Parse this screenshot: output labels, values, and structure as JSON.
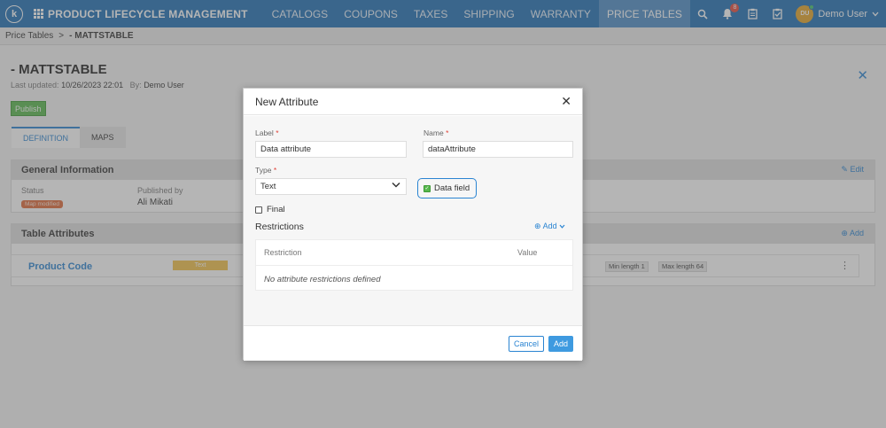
{
  "topbar": {
    "logo": "k",
    "app_title": "PRODUCT LIFECYCLE MANAGEMENT",
    "nav": [
      "CATALOGS",
      "COUPONS",
      "TAXES",
      "SHIPPING",
      "WARRANTY",
      "PRICE TABLES"
    ],
    "active_nav": "PRICE TABLES",
    "notification_count": "8",
    "avatar_initials": "DU",
    "user_name": "Demo User",
    "icons": [
      "search-icon",
      "bell-icon",
      "clipboard-icon",
      "checklist-icon",
      "chevron-down-icon"
    ]
  },
  "breadcrumb": {
    "parent": "Price Tables",
    "separator": ">",
    "current": "- MATTSTABLE"
  },
  "page": {
    "title": "- MATTSTABLE",
    "updated_label": "Last updated:",
    "updated_value": "10/26/2023 22:01",
    "by_label": "By:",
    "by_value": "Demo User",
    "publish_label": "Publish",
    "tabs": [
      "DEFINITION",
      "MAPS"
    ]
  },
  "general": {
    "title": "General Information",
    "edit_label": "Edit",
    "status_label": "Status",
    "status_value": "Map modified",
    "published_by_label": "Published by",
    "published_by_value": "Ali Mikati"
  },
  "table_attributes": {
    "title": "Table Attributes",
    "add_label": "Add",
    "rows": [
      {
        "name": "Product Code",
        "type": "Text",
        "restrictions": [
          "Min length 1",
          "Max length 64"
        ]
      }
    ]
  },
  "modal": {
    "title": "New Attribute",
    "label_label": "Label",
    "label_value": "Data attribute",
    "name_label": "Name",
    "name_value": "dataAttribute",
    "type_label": "Type",
    "type_value": "Text",
    "data_field_label": "Data field",
    "data_field_checked": true,
    "final_label": "Final",
    "final_checked": false,
    "restrictions_title": "Restrictions",
    "add_label": "Add",
    "col_restriction": "Restriction",
    "col_value": "Value",
    "empty_text": "No attribute restrictions defined",
    "cancel_label": "Cancel",
    "submit_label": "Add",
    "required_marker": "*"
  },
  "colors": {
    "primary": "#1f6fb5",
    "accent": "#2a84d2",
    "publish": "#58b84e",
    "status": "#e06b3a",
    "type_badge": "#f2c14a"
  }
}
